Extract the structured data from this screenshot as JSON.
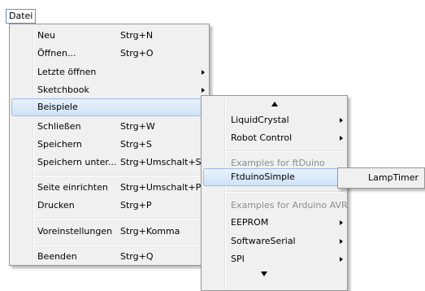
{
  "menubar": {
    "file_label": "Datei"
  },
  "file_menu": {
    "items": [
      {
        "label": "Neu",
        "shortcut": "Strg+N"
      },
      {
        "label": "Öffnen...",
        "shortcut": "Strg+O"
      },
      {
        "label": "Letzte öffnen",
        "shortcut": ""
      },
      {
        "label": "Sketchbook",
        "shortcut": ""
      },
      {
        "label": "Beispiele",
        "shortcut": ""
      },
      {
        "label": "Schließen",
        "shortcut": "Strg+W"
      },
      {
        "label": "Speichern",
        "shortcut": "Strg+S"
      },
      {
        "label": "Speichern unter...",
        "shortcut": "Strg+Umschalt+S"
      },
      {
        "label": "Seite einrichten",
        "shortcut": "Strg+Umschalt+P"
      },
      {
        "label": "Drucken",
        "shortcut": "Strg+P"
      },
      {
        "label": "Voreinstellungen",
        "shortcut": "Strg+Komma"
      },
      {
        "label": "Beenden",
        "shortcut": "Strg+Q"
      }
    ]
  },
  "examples_menu": {
    "items": [
      {
        "label": "LiquidCrystal"
      },
      {
        "label": "Robot Control"
      },
      {
        "label": "Examples for ftDuino"
      },
      {
        "label": "FtduinoSimple"
      },
      {
        "label": "Examples for Arduino AVR"
      },
      {
        "label": "EEPROM"
      },
      {
        "label": "SoftwareSerial"
      },
      {
        "label": "SPI"
      }
    ]
  },
  "ftduino_menu": {
    "items": [
      {
        "label": "LampTimer"
      }
    ]
  },
  "icons": {
    "submenu_arrow": "chevron-right-icon",
    "scroll_up": "scroll-up-icon",
    "scroll_down": "scroll-down-icon"
  },
  "colors": {
    "menu_bg": "#f0f0f0",
    "highlight_bg": "#cfe3f8",
    "highlight_border": "#9bbce0",
    "disabled_text": "#8d8d8d"
  }
}
